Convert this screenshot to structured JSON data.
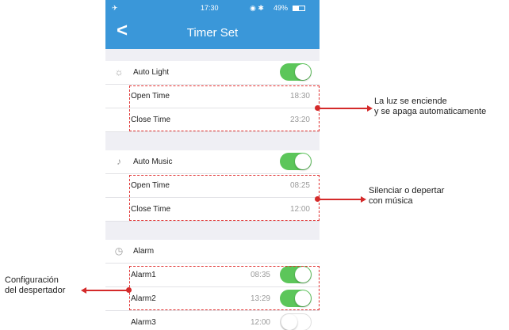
{
  "statusbar": {
    "time": "17:30",
    "battery": "49%"
  },
  "nav": {
    "back_glyph": "<",
    "title": "Timer Set"
  },
  "auto_light": {
    "label": "Auto Light",
    "enabled": true,
    "open_label": "Open Time",
    "open_value": "18:30",
    "close_label": "Close Time",
    "close_value": "23:20"
  },
  "auto_music": {
    "label": "Auto Music",
    "enabled": true,
    "open_label": "Open Time",
    "open_value": "08:25",
    "close_label": "Close Time",
    "close_value": "12:00"
  },
  "alarm": {
    "label": "Alarm",
    "items": [
      {
        "label": "Alarm1",
        "time": "08:35",
        "enabled": true
      },
      {
        "label": "Alarm2",
        "time": "13:29",
        "enabled": true
      },
      {
        "label": "Alarm3",
        "time": "12:00",
        "enabled": false
      }
    ]
  },
  "annotations": {
    "light_line1": "La luz se enciende",
    "light_line2": "y se apaga automaticamente",
    "music_line1": "Silenciar o depertar",
    "music_line2": "con música",
    "alarm_line1": "Configuración",
    "alarm_line2": "del despertador"
  },
  "colors": {
    "nav": "#3a97d9",
    "toggle_on": "#5cc65a",
    "annotation": "#d42a2a"
  }
}
